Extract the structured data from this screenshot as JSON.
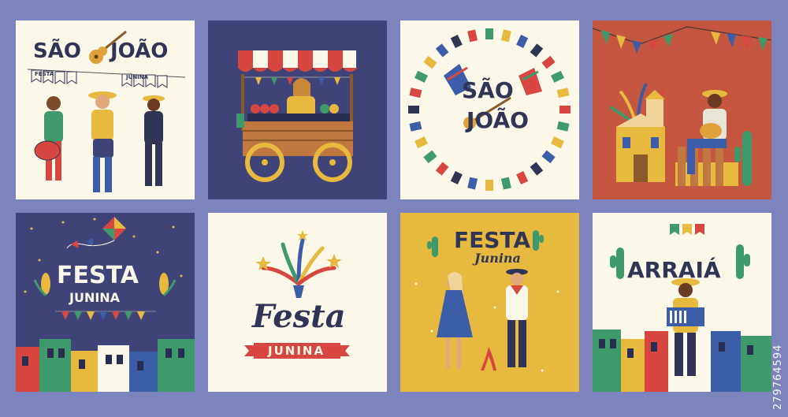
{
  "colors": {
    "background": "#7c83bd",
    "cream": "#fbf7e9",
    "navy": "#3f4377",
    "terracotta": "#c5563f",
    "mustard": "#e8b93f",
    "text_dark": "#303556",
    "red": "#d7473f",
    "green": "#3f9a6b",
    "yellow": "#f2c23d",
    "blue": "#3c5da8"
  },
  "cards": {
    "sao_joao_1": {
      "word1": "SÃO",
      "word2": "JOÃO",
      "flag_text_1": "FESTA",
      "flag_text_2": "JUNINA"
    },
    "market_cart": {},
    "sao_joao_circle": {
      "word1": "SÃO",
      "word2": "JOÃO"
    },
    "church_guitar": {},
    "festa_junina_night": {
      "word1": "FESTA",
      "word2": "JUNINA"
    },
    "festa_junina_script": {
      "word1": "Festa",
      "word2": "JUNINA"
    },
    "festa_junina_dance": {
      "word1": "FESTA",
      "word2": "Junina"
    },
    "arraia": {
      "word1": "ARRAIÁ"
    }
  },
  "watermark": "279764594"
}
